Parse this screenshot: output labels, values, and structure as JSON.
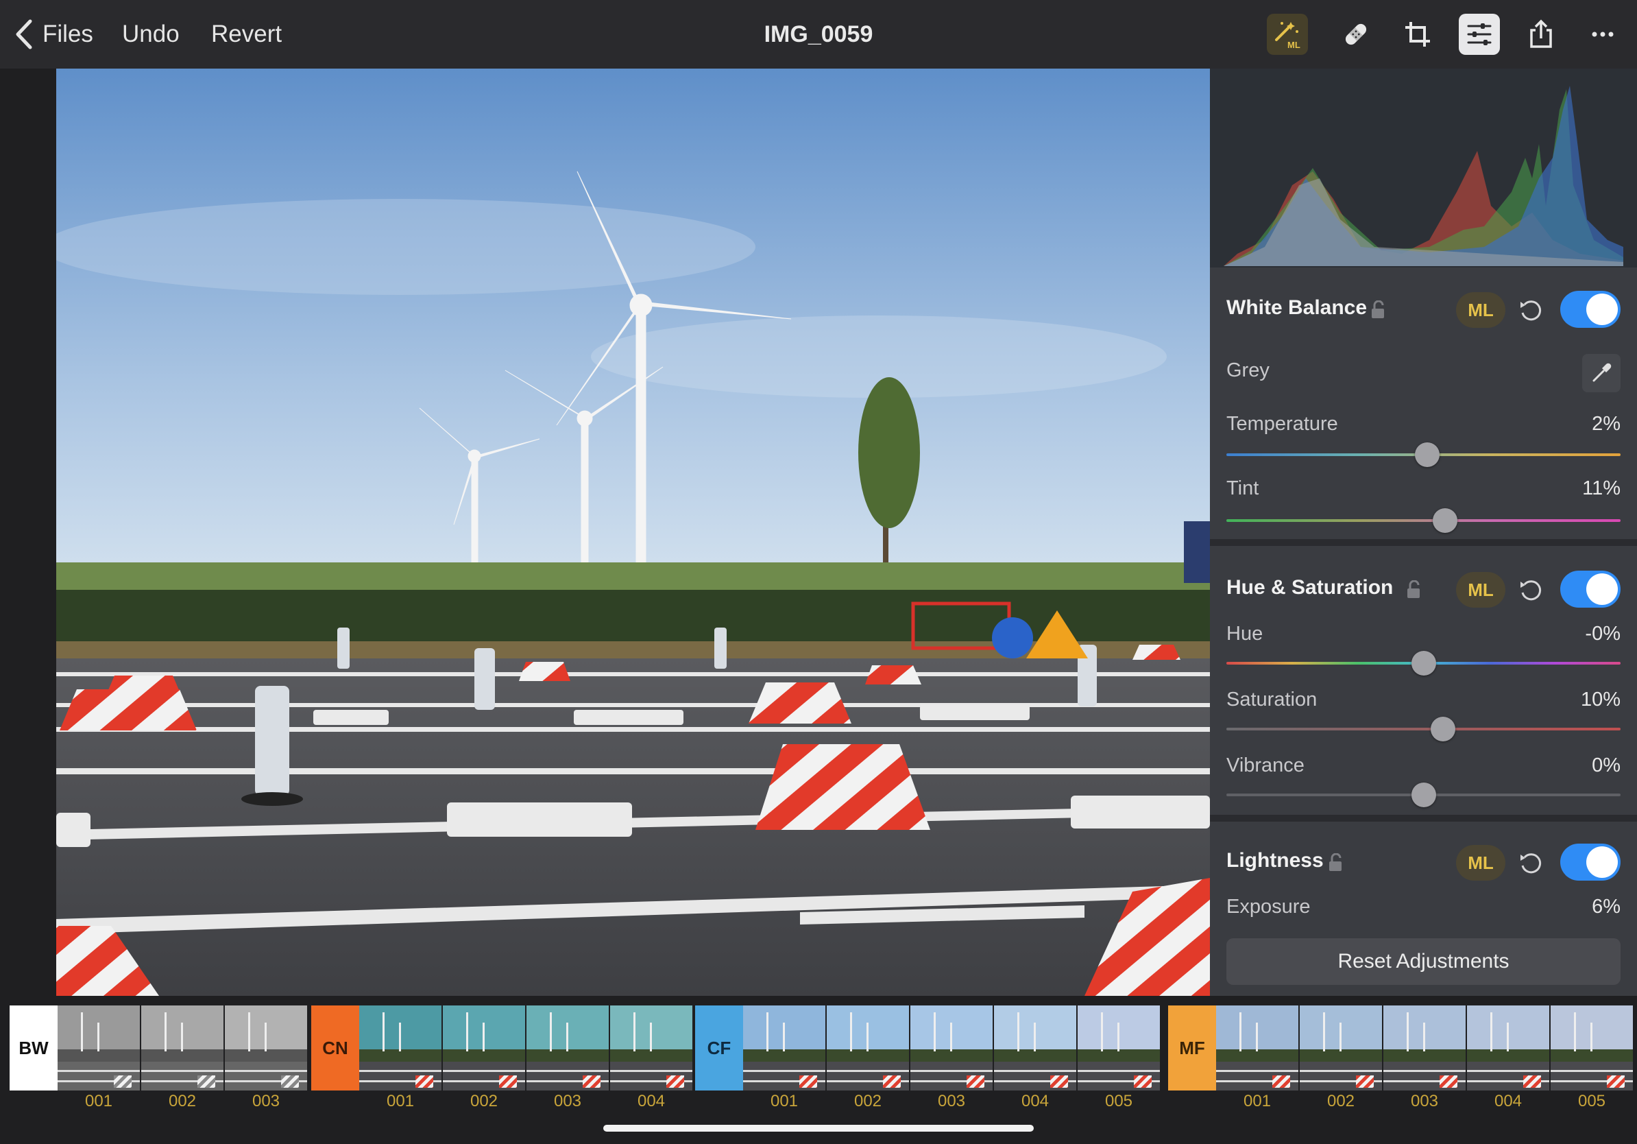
{
  "topbar": {
    "back_label": "Files",
    "undo_label": "Undo",
    "revert_label": "Revert",
    "title": "IMG_0059",
    "tools": [
      "ml-magic-wand-icon",
      "heal-bandage-icon",
      "crop-icon",
      "adjustments-sliders-icon",
      "share-icon",
      "more-icon"
    ],
    "ml_tool_badge": "ML"
  },
  "colors": {
    "accent_blue": "#2f8cf5",
    "ml_gold": "#e6c24a",
    "panel_bg": "#3a3c41",
    "bw_tag": "#ffffff",
    "cn_tag": "#ef6a24",
    "cf_tag": "#4aa5e0",
    "mf_tag": "#f1a23a"
  },
  "panel": {
    "white_balance": {
      "title": "White Balance",
      "ml": "ML",
      "enabled": true,
      "grey_label": "Grey",
      "temperature": {
        "label": "Temperature",
        "value": "2%",
        "position": 0.51
      },
      "tint": {
        "label": "Tint",
        "value": "11%",
        "position": 0.555
      }
    },
    "hue_saturation": {
      "title": "Hue & Saturation",
      "ml": "ML",
      "enabled": true,
      "hue": {
        "label": "Hue",
        "value": "-0%",
        "position": 0.5
      },
      "saturation": {
        "label": "Saturation",
        "value": "10%",
        "position": 0.55
      },
      "vibrance": {
        "label": "Vibrance",
        "value": "0%",
        "position": 0.5
      }
    },
    "lightness": {
      "title": "Lightness",
      "ml": "ML",
      "enabled": true,
      "exposure": {
        "label": "Exposure",
        "value": "6%"
      }
    },
    "reset_label": "Reset Adjustments"
  },
  "filters": [
    {
      "tag": "BW",
      "items": [
        "001",
        "002",
        "003"
      ]
    },
    {
      "tag": "CN",
      "items": [
        "001",
        "002",
        "003",
        "004"
      ]
    },
    {
      "tag": "CF",
      "items": [
        "001",
        "002",
        "003",
        "004",
        "005"
      ]
    },
    {
      "tag": "MF",
      "items": [
        "001",
        "002",
        "003",
        "004",
        "005"
      ]
    }
  ]
}
